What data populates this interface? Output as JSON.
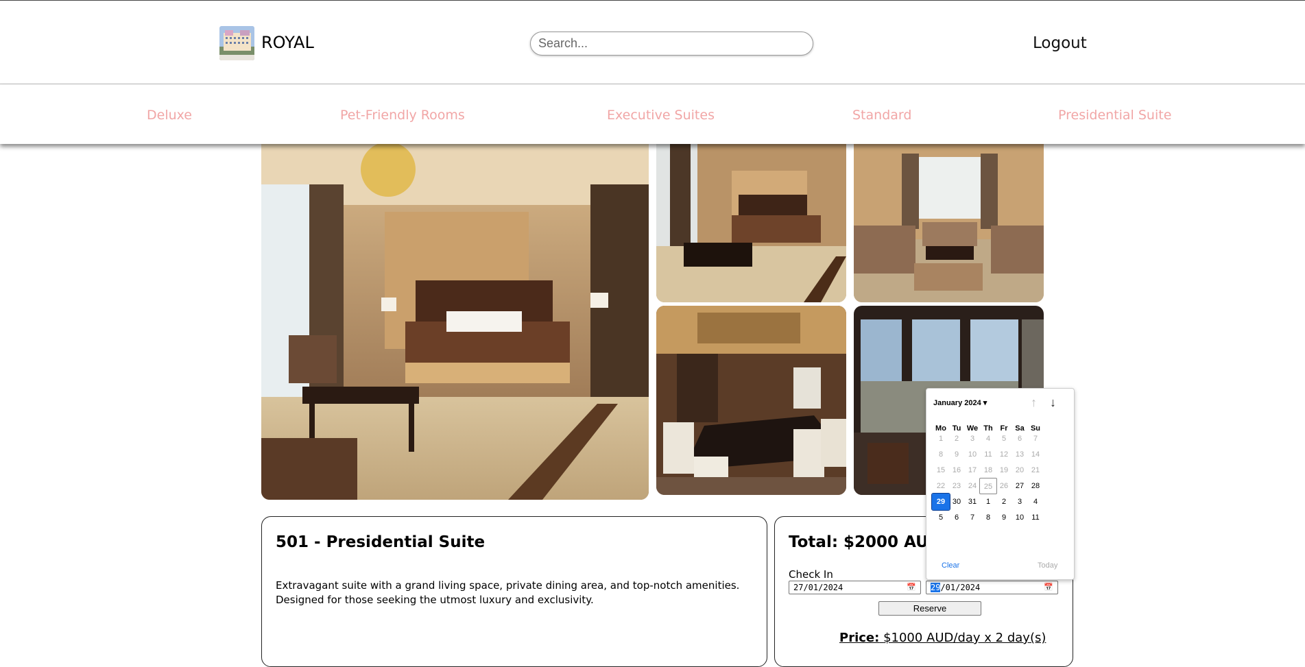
{
  "header": {
    "brand": "ROYAL",
    "search_placeholder": "Search...",
    "logout": "Logout"
  },
  "nav": {
    "items": [
      "Deluxe",
      "Pet-Friendly Rooms",
      "Executive Suites",
      "Standard",
      "Presidential Suite"
    ]
  },
  "room": {
    "title": "501 - Presidential Suite",
    "description": "Extravagant suite with a grand living space, private dining area, and top-notch amenities. Designed for those seeking the utmost luxury and exclusivity."
  },
  "booking": {
    "total": "Total: $2000 AUD",
    "check_in_label": "Check In",
    "check_in_value": "27/01/2024",
    "check_out_day": "29",
    "check_out_rest": "/01/2024",
    "reserve": "Reserve",
    "price_label": "Price:",
    "price_value": "$1000 AUD/day x 2 day(s)"
  },
  "calendar": {
    "month": "January 2024",
    "weekdays": [
      "Mo",
      "Tu",
      "We",
      "Th",
      "Fr",
      "Sa",
      "Su"
    ],
    "weeks": [
      [
        "1",
        "2",
        "3",
        "4",
        "5",
        "6",
        "7"
      ],
      [
        "8",
        "9",
        "10",
        "11",
        "12",
        "13",
        "14"
      ],
      [
        "15",
        "16",
        "17",
        "18",
        "19",
        "20",
        "21"
      ],
      [
        "22",
        "23",
        "24",
        "25",
        "26",
        "27",
        "28"
      ],
      [
        "29",
        "30",
        "31",
        "1",
        "2",
        "3",
        "4"
      ],
      [
        "5",
        "6",
        "7",
        "8",
        "9",
        "10",
        "11"
      ]
    ],
    "clear": "Clear",
    "today": "Today",
    "selected": "29",
    "today_marker": "25"
  }
}
